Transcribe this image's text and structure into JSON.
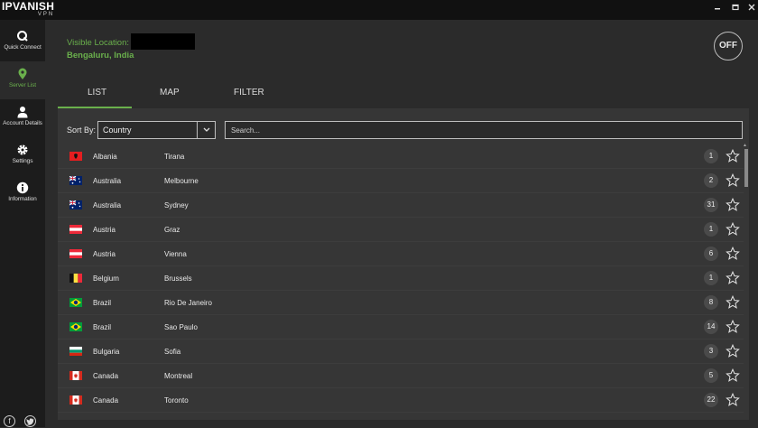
{
  "app": {
    "logo_main": "IPVANISH",
    "logo_sub": "VPN",
    "window_controls": [
      "minimize-icon",
      "maximize-icon",
      "close-icon"
    ]
  },
  "sidebar": {
    "items": [
      {
        "label": "Quick Connect",
        "icon": "quick-connect-icon",
        "active": false
      },
      {
        "label": "Server List",
        "icon": "location-pin-icon",
        "active": true
      },
      {
        "label": "Account Details",
        "icon": "user-icon",
        "active": false
      },
      {
        "label": "Settings",
        "icon": "gear-icon",
        "active": false
      },
      {
        "label": "Information",
        "icon": "info-icon",
        "active": false
      }
    ],
    "social": [
      "facebook-icon",
      "twitter-icon"
    ]
  },
  "header": {
    "visible_location_label": "Visible Location:",
    "location": "Bengaluru, India",
    "toggle_label": "OFF"
  },
  "tabs": [
    {
      "label": "LIST",
      "active": true
    },
    {
      "label": "MAP",
      "active": false
    },
    {
      "label": "FILTER",
      "active": false
    }
  ],
  "controls": {
    "sort_label": "Sort By:",
    "sort_value": "Country",
    "search_placeholder": "Search..."
  },
  "servers": [
    {
      "country": "Albania",
      "city": "Tirana",
      "count": "1",
      "flag": "albania-flag"
    },
    {
      "country": "Australia",
      "city": "Melbourne",
      "count": "2",
      "flag": "australia-flag"
    },
    {
      "country": "Australia",
      "city": "Sydney",
      "count": "31",
      "flag": "australia-flag"
    },
    {
      "country": "Austria",
      "city": "Graz",
      "count": "1",
      "flag": "austria-flag"
    },
    {
      "country": "Austria",
      "city": "Vienna",
      "count": "6",
      "flag": "austria-flag"
    },
    {
      "country": "Belgium",
      "city": "Brussels",
      "count": "1",
      "flag": "belgium-flag"
    },
    {
      "country": "Brazil",
      "city": "Rio De Janeiro",
      "count": "8",
      "flag": "brazil-flag"
    },
    {
      "country": "Brazil",
      "city": "Sao Paulo",
      "count": "14",
      "flag": "brazil-flag"
    },
    {
      "country": "Bulgaria",
      "city": "Sofia",
      "count": "3",
      "flag": "bulgaria-flag"
    },
    {
      "country": "Canada",
      "city": "Montreal",
      "count": "5",
      "flag": "canada-flag"
    },
    {
      "country": "Canada",
      "city": "Toronto",
      "count": "22",
      "flag": "canada-flag"
    }
  ],
  "colors": {
    "accent": "#6ab04c",
    "background": "#2b2b2b",
    "sidebar": "#1c1c1c",
    "panel": "#363636"
  }
}
